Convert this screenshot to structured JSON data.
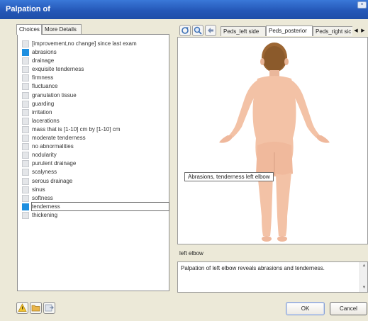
{
  "window": {
    "title": "Palpation of",
    "close_glyph": "×"
  },
  "left_tabs": [
    "Choices",
    "More Details"
  ],
  "choices": [
    {
      "label": "[improvement,no change] since last exam",
      "checked": false
    },
    {
      "label": "abrasions",
      "checked": true
    },
    {
      "label": "drainage",
      "checked": false
    },
    {
      "label": "exquisite tenderness",
      "checked": false
    },
    {
      "label": "firmness",
      "checked": false
    },
    {
      "label": "fluctuance",
      "checked": false
    },
    {
      "label": "granulation tissue",
      "checked": false
    },
    {
      "label": "guarding",
      "checked": false
    },
    {
      "label": "irritation",
      "checked": false
    },
    {
      "label": "lacerations",
      "checked": false
    },
    {
      "label": "mass that is [1-10] cm by [1-10] cm",
      "checked": false
    },
    {
      "label": "moderate tenderness",
      "checked": false
    },
    {
      "label": "no abnormalities",
      "checked": false
    },
    {
      "label": "nodularity",
      "checked": false
    },
    {
      "label": "purulent drainage",
      "checked": false
    },
    {
      "label": "scalyness",
      "checked": false
    },
    {
      "label": "serous drainage",
      "checked": false
    },
    {
      "label": "sinus",
      "checked": false
    },
    {
      "label": "softness",
      "checked": false
    },
    {
      "label": "tenderness",
      "checked": true,
      "focused": true
    },
    {
      "label": "thickening",
      "checked": false
    }
  ],
  "view_tabs": [
    "Peds_left side",
    "Peds_posterior",
    "Peds_right sic"
  ],
  "view_tools": [
    "rotate-icon",
    "zoom-icon",
    "back-arrow-icon"
  ],
  "scroll_arrows": [
    "◀",
    "▶"
  ],
  "tooltip": "Abrasions, tenderness left elbow",
  "location_label": "left elbow",
  "description": "Palpation of left elbow reveals abrasions and tenderness.",
  "desc_scroll": [
    "▲",
    "▼"
  ],
  "bottom_icons": [
    "warning-icon",
    "folder-icon",
    "export-icon"
  ],
  "buttons": {
    "ok": "OK",
    "cancel": "Cancel"
  },
  "colors": {
    "title_bar": "#2558b8",
    "check_accent": "#1e8fe0",
    "skin": "#f3c2a6",
    "hair": "#8b5a2b"
  }
}
